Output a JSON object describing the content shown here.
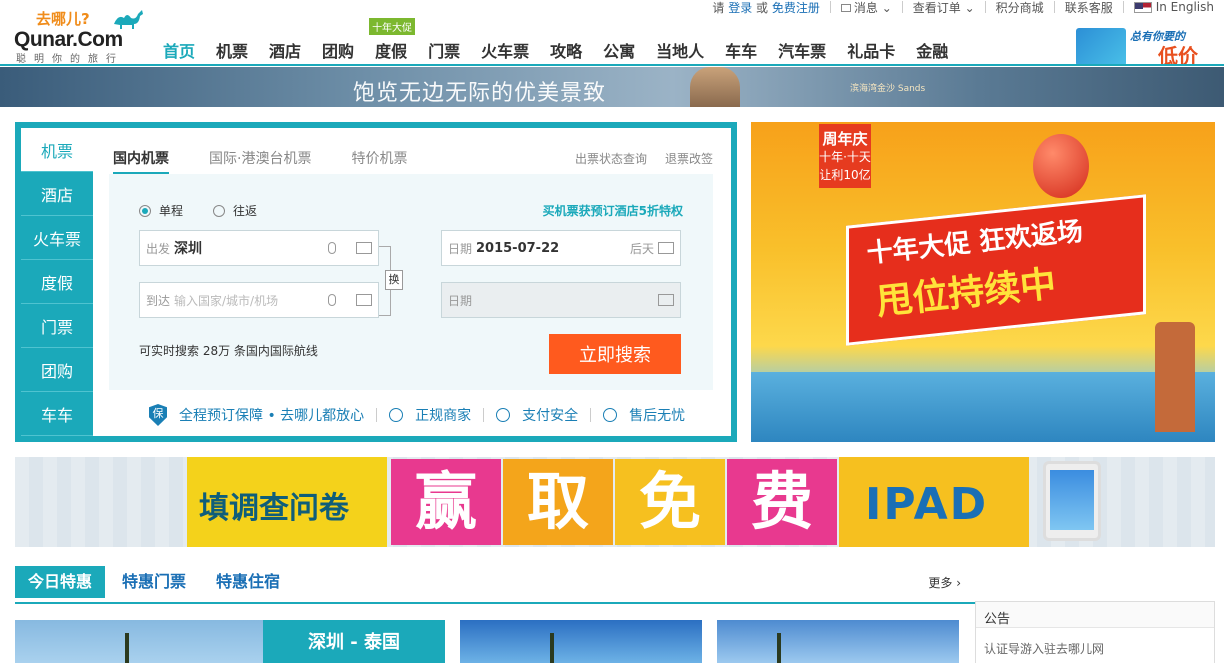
{
  "topbar": {
    "please": "请",
    "login": "登录",
    "or": "或",
    "register": "免费注册",
    "messages": "消息",
    "orders": "查看订单",
    "mall": "积分商城",
    "service": "联系客服",
    "english": "In English"
  },
  "logo": {
    "cn": "去哪儿?",
    "en": "Qunar.Com",
    "tagline": "聪明你的旅行"
  },
  "nav": {
    "badge": "十年大促",
    "items": [
      "首页",
      "机票",
      "酒店",
      "团购",
      "度假",
      "门票",
      "火车票",
      "攻略",
      "公寓",
      "当地人",
      "车车",
      "汽车票",
      "礼品卡",
      "金融"
    ]
  },
  "app_promo": {
    "line1": "总有你要的",
    "line2": "低价"
  },
  "top_banner": {
    "text": "饱览无边无际的优美景致",
    "brand": "滨海湾金沙 Sands"
  },
  "search": {
    "side_tabs": [
      "机票",
      "酒店",
      "火车票",
      "度假",
      "门票",
      "团购",
      "车车"
    ],
    "top_tabs": [
      "国内机票",
      "国际·港澳台机票",
      "特价机票"
    ],
    "status_link": "出票状态查询",
    "refund_link": "退票改签",
    "trip_oneway": "单程",
    "trip_round": "往返",
    "promo_link": "买机票获预订酒店5折特权",
    "from_label": "出发",
    "from_value": "深圳",
    "to_label": "到达",
    "to_placeholder": "输入国家/城市/机场",
    "swap": "换",
    "date_label": "日期",
    "date_value": "2015-07-22",
    "date_hint": "后天",
    "return_label": "日期",
    "count_text": "可实时搜索 28万 条国内国际航线",
    "search_button": "立即搜索",
    "assurance": {
      "shield": "保",
      "main": "全程预订保障 • 去哪儿都放心",
      "items": [
        "正规商家",
        "支付安全",
        "售后无忧"
      ]
    }
  },
  "right_ad": {
    "anniv_top": "周年庆",
    "anniv_sub": "十年·十天",
    "anniv_sub2": "让利10亿",
    "line1": "十年大促 狂欢返场",
    "line2": "甩位持续中"
  },
  "mid_banner": {
    "text": "填调查问卷",
    "big": [
      "赢",
      "取",
      "免",
      "费"
    ],
    "product": "IPAD"
  },
  "deals": {
    "tabs": [
      "今日特惠",
      "特惠门票",
      "特惠住宿"
    ],
    "more": "更多",
    "first_label": "深圳 - 泰国"
  },
  "notice": {
    "title": "公告",
    "item": "认证导游入驻去哪儿网"
  }
}
